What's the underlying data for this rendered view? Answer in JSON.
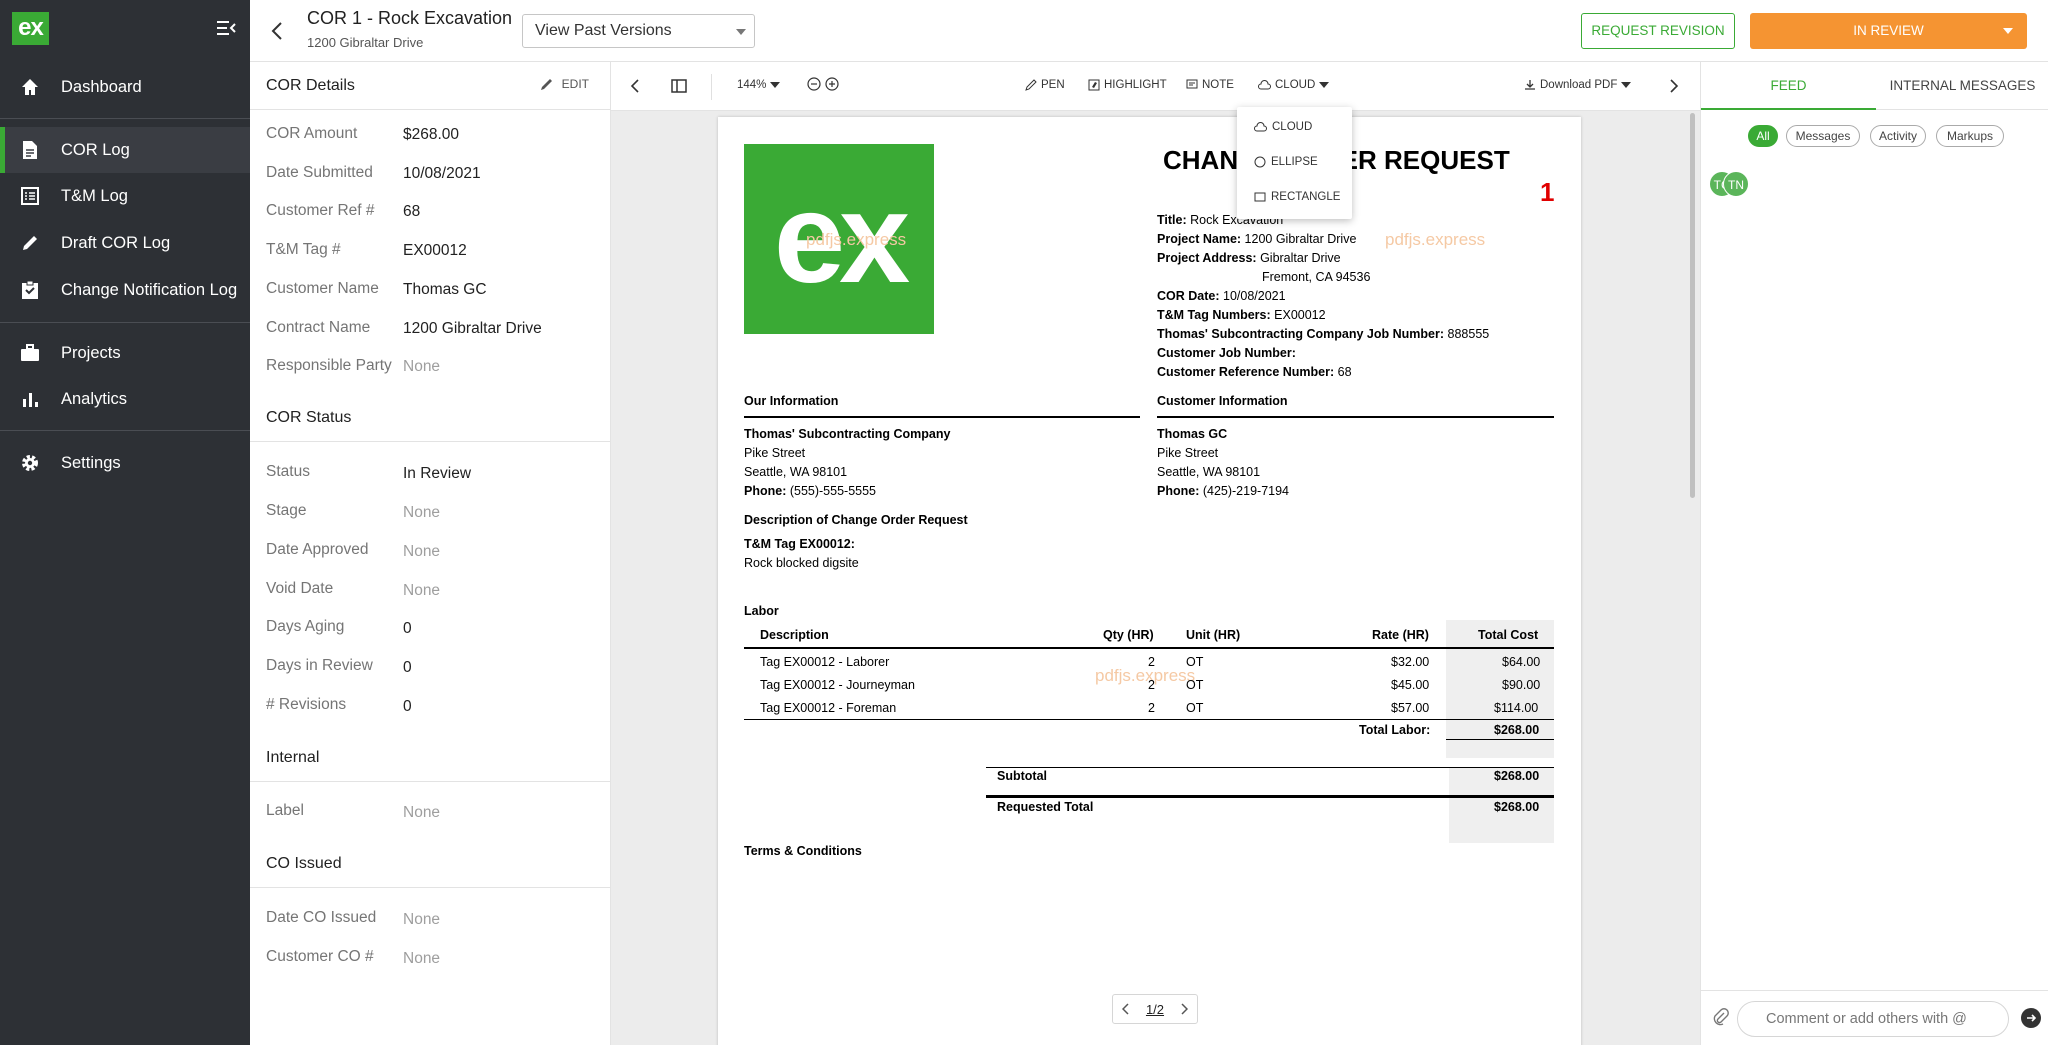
{
  "sidebar": {
    "logo": "ex",
    "items": [
      {
        "label": "Dashboard",
        "icon": "home-icon"
      },
      {
        "label": "COR Log",
        "icon": "document-icon",
        "active": true
      },
      {
        "label": "T&M Log",
        "icon": "list-icon"
      },
      {
        "label": "Draft COR Log",
        "icon": "pencil-icon"
      },
      {
        "label": "Change Notification Log",
        "icon": "clipboard-icon"
      },
      {
        "label": "Projects",
        "icon": "briefcase-icon"
      },
      {
        "label": "Analytics",
        "icon": "bar-chart-icon"
      },
      {
        "label": "Settings",
        "icon": "gear-icon"
      }
    ]
  },
  "header": {
    "title": "COR 1 - Rock Excavation",
    "subtitle": "1200 Gibraltar Drive",
    "versions_select": "View Past Versions",
    "request_revision": "REQUEST REVISION",
    "status_button": "IN REVIEW"
  },
  "details": {
    "cor_details_title": "COR Details",
    "edit_label": "EDIT",
    "fields": [
      {
        "label": "COR Amount",
        "value": "$268.00"
      },
      {
        "label": "Date Submitted",
        "value": "10/08/2021"
      },
      {
        "label": "Customer Ref #",
        "value": "68"
      },
      {
        "label": "T&M Tag #",
        "value": "EX00012"
      },
      {
        "label": "Customer Name",
        "value": "Thomas GC"
      },
      {
        "label": "Contract Name",
        "value": "1200 Gibraltar Drive"
      },
      {
        "label": "Responsible Party",
        "value": "None"
      }
    ],
    "status_title": "COR Status",
    "status_fields": [
      {
        "label": "Status",
        "value": "In Review"
      },
      {
        "label": "Stage",
        "value": "None"
      },
      {
        "label": "Date Approved",
        "value": "None"
      },
      {
        "label": "Void Date",
        "value": "None"
      },
      {
        "label": "Days Aging",
        "value": "0"
      },
      {
        "label": "Days in Review",
        "value": "0"
      },
      {
        "label": "# Revisions",
        "value": "0"
      }
    ],
    "internal_title": "Internal",
    "internal_fields": [
      {
        "label": "Label",
        "value": "None"
      }
    ],
    "co_title": "CO Issued",
    "co_fields": [
      {
        "label": "Date CO Issued",
        "value": "None"
      },
      {
        "label": "Customer CO #",
        "value": "None"
      }
    ]
  },
  "toolbar": {
    "zoom": "144%",
    "pen": "PEN",
    "highlight": "HIGHLIGHT",
    "note": "NOTE",
    "cloud": "CLOUD",
    "download": "Download PDF",
    "shape_menu": [
      "CLOUD",
      "ELLIPSE",
      "RECTANGLE"
    ]
  },
  "document": {
    "logo_text": "ex",
    "heading": "CHANGE ORDER REQUEST",
    "number": "1",
    "watermark": "pdfjs.express",
    "title_label": "Title:",
    "title_value": "Rock Excavation",
    "project_name_label": "Project Name:",
    "project_name_value": "1200 Gibraltar Drive",
    "project_address_label": "Project Address:",
    "project_address_1": "Gibraltar Drive",
    "project_address_2": "Fremont, CA 94536",
    "cor_date_label": "COR Date:",
    "cor_date_value": "10/08/2021",
    "tm_tags_label": "T&M Tag Numbers:",
    "tm_tags_value": "EX00012",
    "job_number_label": "Thomas' Subcontracting Company Job Number:",
    "job_number_value": "888555",
    "customer_job_label": "Customer Job Number:",
    "customer_ref_label": "Customer Reference Number:",
    "customer_ref_value": "68",
    "our_info_title": "Our Information",
    "our_company": "Thomas' Subcontracting Company",
    "our_street": "Pike Street",
    "our_city": "Seattle, WA 98101",
    "our_phone_label": "Phone:",
    "our_phone": "(555)-555-5555",
    "customer_info_title": "Customer Information",
    "customer_company": "Thomas GC",
    "customer_street": "Pike Street",
    "customer_city": "Seattle, WA 98101",
    "customer_phone_label": "Phone:",
    "customer_phone": "(425)-219-7194",
    "description_title": "Description of Change Order Request",
    "description_tag": "T&M Tag EX00012:",
    "description_text": "Rock blocked digsite",
    "labor_title": "Labor",
    "labor_headers": [
      "Description",
      "Qty (HR)",
      "Unit (HR)",
      "Rate (HR)",
      "Total Cost"
    ],
    "labor_rows": [
      [
        "Tag EX00012 - Laborer",
        "2",
        "OT",
        "$32.00",
        "$64.00"
      ],
      [
        "Tag EX00012 - Journeyman",
        "2",
        "OT",
        "$45.00",
        "$90.00"
      ],
      [
        "Tag EX00012 - Foreman",
        "2",
        "OT",
        "$57.00",
        "$114.00"
      ]
    ],
    "total_labor_label": "Total Labor:",
    "total_labor": "$268.00",
    "subtotal_label": "Subtotal",
    "subtotal": "$268.00",
    "requested_total_label": "Requested Total",
    "requested_total": "$268.00",
    "terms_title": "Terms & Conditions",
    "page_indicator": "1/2"
  },
  "feed": {
    "tabs": [
      "FEED",
      "INTERNAL MESSAGES"
    ],
    "filters": [
      "All",
      "Messages",
      "Activity",
      "Markups"
    ],
    "avatars": [
      "TG",
      "TN"
    ],
    "comment_placeholder": "Comment or add others with @"
  },
  "colors": {
    "brand_green": "#3aaa35",
    "sidebar_bg": "#2d3035",
    "review_orange": "#f59432",
    "doc_number_red": "#e00000"
  }
}
